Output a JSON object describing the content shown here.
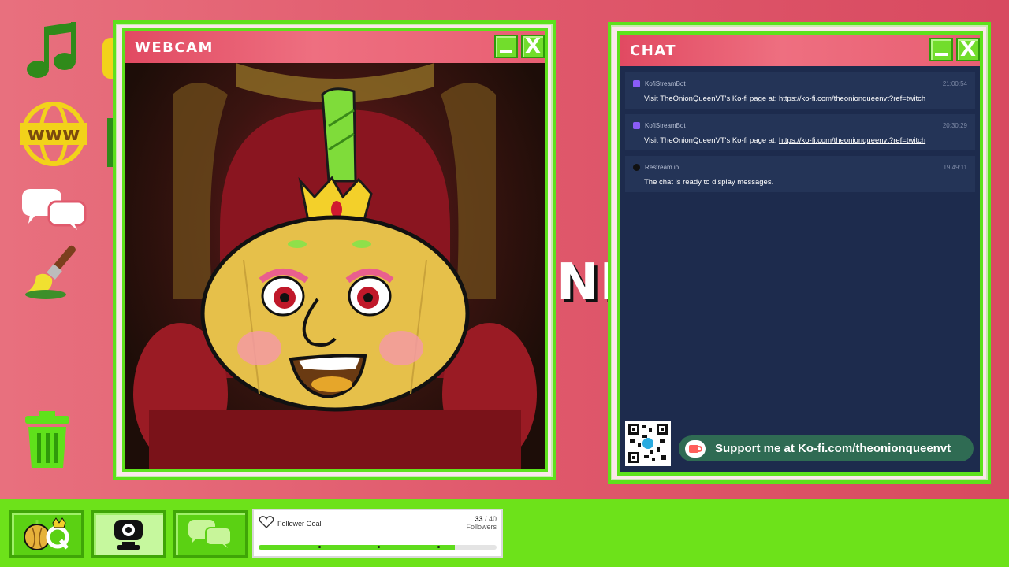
{
  "desktop_icons": [
    "music-note-icon",
    "www-globe-icon",
    "chat-bubbles-icon",
    "paintbrush-icon",
    "trash-can-icon"
  ],
  "background_text": "NI",
  "webcam_window": {
    "title": "WEBCAM",
    "minimize_label": "_",
    "close_label": "X"
  },
  "chat_window": {
    "title": "CHAT",
    "minimize_label": "_",
    "close_label": "X",
    "messages": [
      {
        "source_icon": "twitch-icon",
        "author": "KofiStreamBot",
        "time": "21:00:54",
        "text": "Visit TheOnionQueenVT's Ko-fi page at: ",
        "link": "https://ko-fi.com/theonionqueenvt?ref=twitch"
      },
      {
        "source_icon": "twitch-icon",
        "author": "KofiStreamBot",
        "time": "20:30:29",
        "text": "Visit TheOnionQueenVT's Ko-fi page at: ",
        "link": "https://ko-fi.com/theonionqueenvt?ref=twitch"
      },
      {
        "source_icon": "restream-icon",
        "author": "Restream.io",
        "time": "19:49:11",
        "text": "The chat is ready to display messages.",
        "link": ""
      }
    ],
    "kofi_banner": "Support me at Ko-fi.com/theonionqueenvt"
  },
  "taskbar": {
    "apps": [
      "onion-queen-logo-icon",
      "webcam-icon",
      "chat-bubbles-icon"
    ],
    "follower_goal": {
      "label": "Follower Goal",
      "current": "33",
      "separator": " / ",
      "target": "40",
      "unit": "Followers",
      "progress": 0.825
    }
  },
  "colors": {
    "accent_green": "#5ee11c",
    "titlebar_pink": "#e14a62",
    "chat_bg": "#1d2b4d",
    "kofi_green": "#2f6b53"
  }
}
